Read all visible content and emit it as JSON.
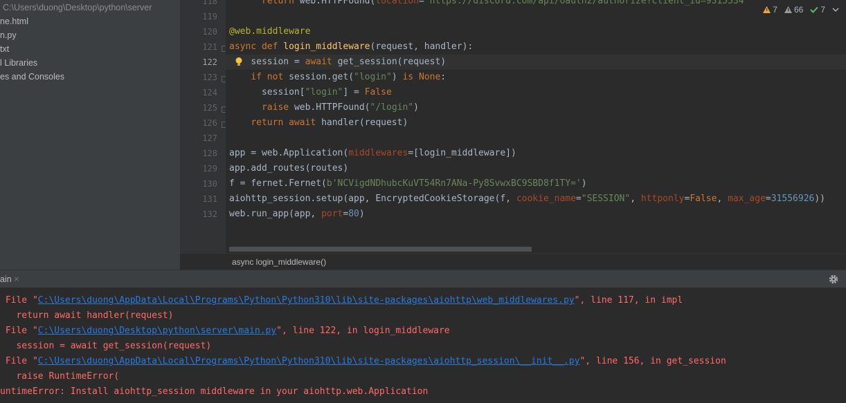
{
  "sidebar": {
    "path": "C:\\Users\\duong\\Desktop\\python\\server",
    "items": [
      {
        "label": "ne.html"
      },
      {
        "label": "n.py"
      },
      {
        "label": "txt"
      },
      {
        "label": "l Libraries"
      },
      {
        "label": "es and Consoles"
      }
    ]
  },
  "inspections": {
    "warnings": "7",
    "weak_warnings": "66",
    "typos": "7"
  },
  "editor": {
    "line_numbers": [
      "118",
      "119",
      "120",
      "121",
      "122",
      "123",
      "124",
      "125",
      "126",
      "127",
      "128",
      "129",
      "130",
      "131",
      "132"
    ],
    "current_line": "122",
    "lines": [
      {
        "n": "118",
        "indent": "      ",
        "parts": [
          {
            "t": "return ",
            "c": "kw"
          },
          {
            "t": "web.HTTPFound(",
            "c": ""
          },
          {
            "t": "location",
            "c": "param"
          },
          {
            "t": "=",
            "c": ""
          },
          {
            "t": "\"https://discord.com/api/oauth2/authorize?client_id=9315534",
            "c": "str"
          }
        ]
      },
      {
        "n": "119",
        "indent": "",
        "parts": []
      },
      {
        "n": "120",
        "indent": "",
        "parts": [
          {
            "t": "@web.middleware",
            "c": "dec"
          }
        ]
      },
      {
        "n": "121",
        "indent": "",
        "parts": [
          {
            "t": "async def ",
            "c": "kw"
          },
          {
            "t": "login_middleware",
            "c": "fn"
          },
          {
            "t": "(request, handler):",
            "c": ""
          }
        ]
      },
      {
        "n": "122",
        "indent": "    ",
        "parts": [
          {
            "t": "session = ",
            "c": ""
          },
          {
            "t": "await ",
            "c": "kw"
          },
          {
            "t": "get_session(request)",
            "c": ""
          }
        ]
      },
      {
        "n": "123",
        "indent": "    ",
        "parts": [
          {
            "t": "if not ",
            "c": "kw"
          },
          {
            "t": "session.get(",
            "c": ""
          },
          {
            "t": "\"login\"",
            "c": "str"
          },
          {
            "t": ") ",
            "c": ""
          },
          {
            "t": "is None",
            "c": "kw"
          },
          {
            "t": ":",
            "c": ""
          }
        ]
      },
      {
        "n": "124",
        "indent": "      ",
        "parts": [
          {
            "t": "session[",
            "c": ""
          },
          {
            "t": "\"login\"",
            "c": "str"
          },
          {
            "t": "] = ",
            "c": ""
          },
          {
            "t": "False",
            "c": "kw"
          }
        ]
      },
      {
        "n": "125",
        "indent": "      ",
        "parts": [
          {
            "t": "raise ",
            "c": "kw"
          },
          {
            "t": "web.HTTPFound(",
            "c": ""
          },
          {
            "t": "\"/login\"",
            "c": "str"
          },
          {
            "t": ")",
            "c": ""
          }
        ]
      },
      {
        "n": "126",
        "indent": "    ",
        "parts": [
          {
            "t": "return await ",
            "c": "kw"
          },
          {
            "t": "handler(request)",
            "c": ""
          }
        ]
      },
      {
        "n": "127",
        "indent": "",
        "parts": []
      },
      {
        "n": "128",
        "indent": "",
        "parts": [
          {
            "t": "app = web.Application(",
            "c": ""
          },
          {
            "t": "middlewares",
            "c": "param"
          },
          {
            "t": "=[login_middleware])",
            "c": ""
          }
        ]
      },
      {
        "n": "129",
        "indent": "",
        "parts": [
          {
            "t": "app.add_routes(routes)",
            "c": ""
          }
        ]
      },
      {
        "n": "130",
        "indent": "",
        "parts": [
          {
            "t": "f = fernet.Fernet(",
            "c": ""
          },
          {
            "t": "b'NCVigdNDhubcKuVT54Rn7ANa-Py8SvwxBC9SBD8f1TY='",
            "c": "str"
          },
          {
            "t": ")",
            "c": ""
          }
        ]
      },
      {
        "n": "131",
        "indent": "",
        "parts": [
          {
            "t": "aiohttp_session.setup(app, EncryptedCookieStorage(f, ",
            "c": ""
          },
          {
            "t": "cookie_name",
            "c": "param"
          },
          {
            "t": "=",
            "c": ""
          },
          {
            "t": "\"SESSION\"",
            "c": "str"
          },
          {
            "t": ", ",
            "c": ""
          },
          {
            "t": "httponly",
            "c": "param"
          },
          {
            "t": "=",
            "c": ""
          },
          {
            "t": "False",
            "c": "kw"
          },
          {
            "t": ", ",
            "c": ""
          },
          {
            "t": "max_age",
            "c": "param"
          },
          {
            "t": "=",
            "c": ""
          },
          {
            "t": "31556926",
            "c": "num"
          },
          {
            "t": "))",
            "c": ""
          }
        ]
      },
      {
        "n": "132",
        "indent": "",
        "parts": [
          {
            "t": "web.run_app(app, ",
            "c": ""
          },
          {
            "t": "port",
            "c": "param"
          },
          {
            "t": "=",
            "c": ""
          },
          {
            "t": "80",
            "c": "num"
          },
          {
            "t": ")",
            "c": ""
          }
        ]
      }
    ]
  },
  "breadcrumb": {
    "label": "async login_middleware()"
  },
  "run_window": {
    "tab_label": "ain",
    "close_glyph": "×",
    "lines": [
      {
        "parts": [
          {
            "t": "   ",
            "link": false
          }
        ]
      },
      {
        "parts": [
          {
            "t": " File \"",
            "link": false
          },
          {
            "t": "C:\\Users\\duong\\AppData\\Local\\Programs\\Python\\Python310\\lib\\site-packages\\aiohttp\\web_middlewares.py",
            "link": true
          },
          {
            "t": "\", line 117, in impl",
            "link": false
          }
        ]
      },
      {
        "parts": [
          {
            "t": "   return await handler(request)",
            "link": false
          }
        ]
      },
      {
        "parts": [
          {
            "t": " File \"",
            "link": false
          },
          {
            "t": "C:\\Users\\duong\\Desktop\\python\\server\\main.py",
            "link": true
          },
          {
            "t": "\", line 122, in login_middleware",
            "link": false
          }
        ]
      },
      {
        "parts": [
          {
            "t": "   session = await get_session(request)",
            "link": false
          }
        ]
      },
      {
        "parts": [
          {
            "t": " File \"",
            "link": false
          },
          {
            "t": "C:\\Users\\duong\\AppData\\Local\\Programs\\Python\\Python310\\lib\\site-packages\\aiohttp_session\\__init__.py",
            "link": true
          },
          {
            "t": "\", line 156, in get_session",
            "link": false
          }
        ]
      },
      {
        "parts": [
          {
            "t": "   raise RuntimeError(",
            "link": false
          }
        ]
      },
      {
        "parts": [
          {
            "t": "untimeError: Install aiohttp_session middleware in your aiohttp.web.Application",
            "link": false
          }
        ]
      }
    ]
  }
}
